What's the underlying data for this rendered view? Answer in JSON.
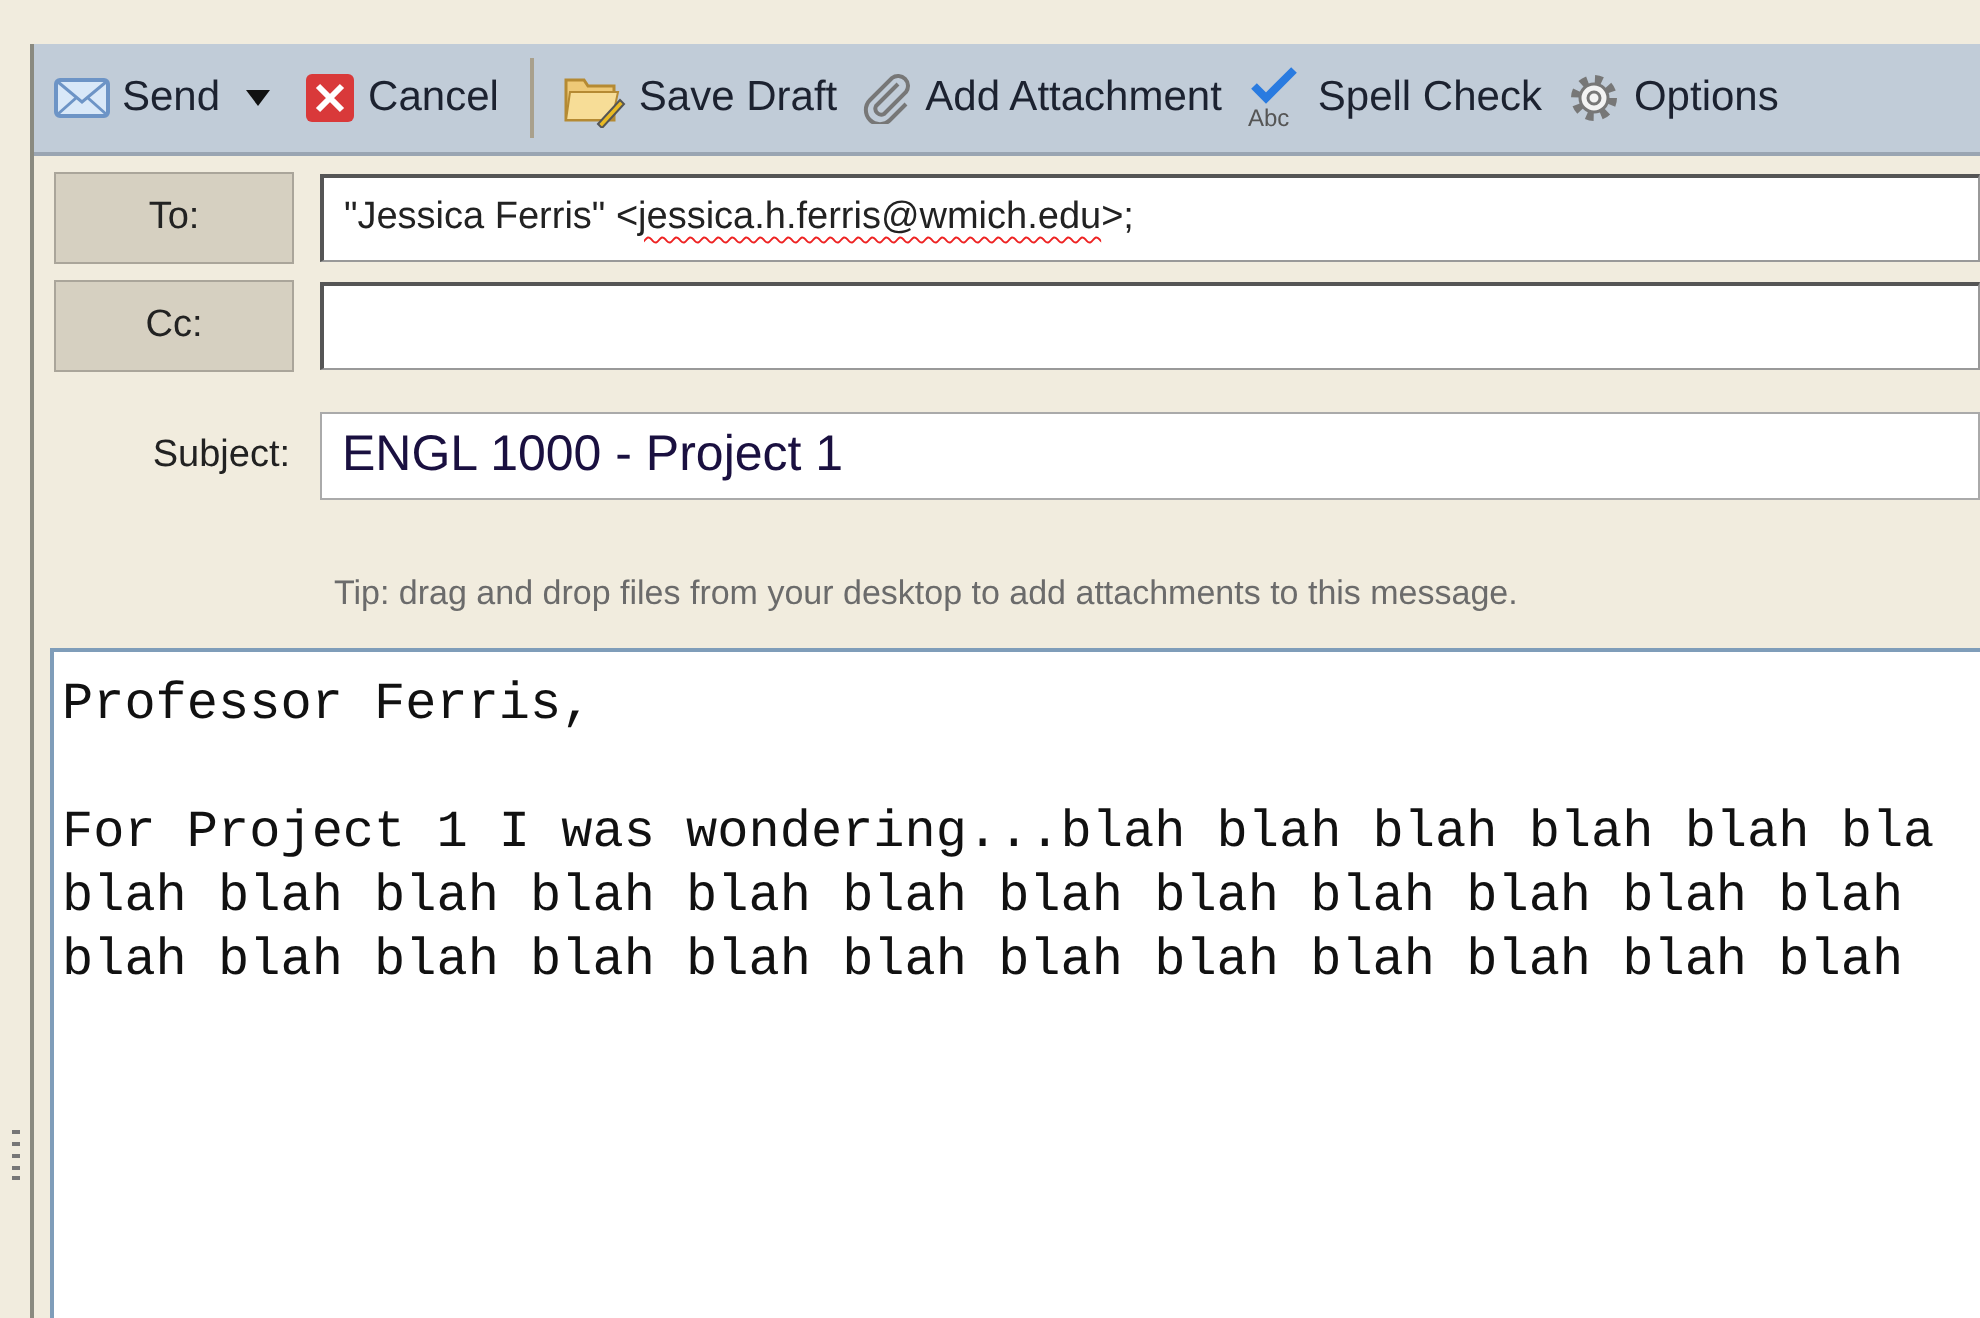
{
  "toolbar": [
    {
      "kind": "send",
      "label": "Send"
    },
    {
      "kind": "menu_caret"
    },
    {
      "kind": "cancel",
      "label": "Cancel"
    },
    {
      "kind": "separator"
    },
    {
      "kind": "draft",
      "label": "Save Draft"
    },
    {
      "kind": "attach",
      "label": "Add Attachment"
    },
    {
      "kind": "spell",
      "label": "Spell Check",
      "icon_text": "Abc"
    },
    {
      "kind": "options",
      "label": "Options"
    }
  ],
  "fields": [
    {
      "kind": "button",
      "label": "To:",
      "value_parts": [
        {
          "text": "\"Jessica Ferris\" <",
          "misspelled": false
        },
        {
          "text": "jessica.h.ferris@wmich.edu",
          "misspelled": true
        },
        {
          "text": ">;",
          "misspelled": false
        }
      ]
    },
    {
      "kind": "button",
      "label": "Cc:"
    },
    {
      "kind": "plain",
      "label": "Subject:",
      "value_parts": [
        {
          "text": "ENGL 1000 - Project 1",
          "misspelled": false
        }
      ]
    }
  ],
  "tip": "Tip: drag and drop files from your desktop to add attachments to this message.",
  "body": {
    "paragraphs": [
      [
        "Professor Ferris,"
      ],
      [
        "For Project 1 I was wondering...blah blah blah blah blah bla",
        "blah blah blah blah blah blah blah blah blah blah blah blah",
        "blah blah blah blah blah blah blah blah blah blah blah blah"
      ]
    ]
  }
}
